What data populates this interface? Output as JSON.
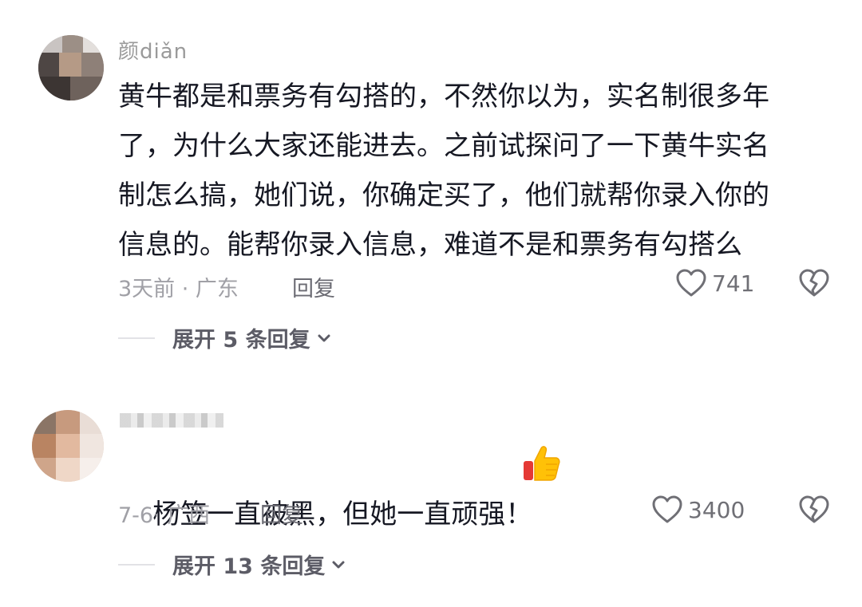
{
  "comments": [
    {
      "username": "颜diǎn",
      "text": "黄牛都是和票务有勾搭的，不然你以为，实名制很多年\n了，为什么大家还能进去。之前试探问了一下黄牛实名\n制怎么搞，她们说，你确定买了，他们就帮你录入你的\n信息的。能帮你录入信息，难道不是和票务有勾搭么",
      "meta": "3天前 · 广东",
      "reply_label": "回复",
      "likes": "741",
      "expand_label": "展开 5 条回复"
    },
    {
      "username": "",
      "text": "杨笠一直被黑，但她一直顽强！",
      "meta": "7-6· 广西",
      "reply_label": "回复",
      "likes": "3400",
      "expand_label": "展开 13 条回复"
    }
  ],
  "icons": {
    "like": "heart-outline-icon",
    "dislike": "broken-heart-icon",
    "expand": "chevron-down-icon",
    "emoji": "thumbs-up-emoji"
  }
}
